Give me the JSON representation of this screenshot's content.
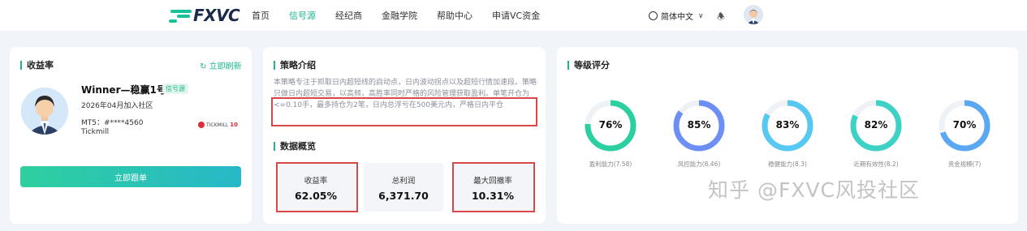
{
  "nav": {
    "logo_text": "FXVC",
    "items": [
      "首页",
      "信号源",
      "经纪商",
      "金融学院",
      "帮助中心",
      "申请VC资金"
    ],
    "active_index": 1,
    "language": "简体中文"
  },
  "profit_card": {
    "title": "收益率",
    "refresh": "立即刷新",
    "trader_name": "Winner—稳赢1号",
    "badge": "信号源",
    "joined": "2026年04月加入社区",
    "mt5": "MT5：#****4560",
    "broker": "Tickmill",
    "broker_logo": "TICKMILL",
    "broker_logo_suffix": "10",
    "follow_button": "立即跟单"
  },
  "strategy_card": {
    "title": "策略介绍",
    "description": "本策略专注于抓取日内超短线的启动点，日内波动拐点以及超短行情加速段。策略只做日内超短交易，以高频，高胜率同时严格的风险管理获取盈利。单笔开仓为<=0.10手，最多持仓为2笔，日内总浮亏在500美元内，严格日内平仓",
    "overview_title": "数据概览",
    "stats": [
      {
        "label": "收益率",
        "value": "62.05%"
      },
      {
        "label": "总利润",
        "value": "6,371.70"
      },
      {
        "label": "最大回撤率",
        "value": "10.31%"
      }
    ]
  },
  "rating_card": {
    "title": "等级评分",
    "gauges": [
      {
        "value": "76%",
        "percent": 76,
        "label": "盈利能力(7.58)",
        "color": "#2ccfa0"
      },
      {
        "value": "85%",
        "percent": 85,
        "label": "风控能力(8.46)",
        "color": "#6c8ef5"
      },
      {
        "value": "83%",
        "percent": 83,
        "label": "稳健能力(8.3)",
        "color": "#56c8f2"
      },
      {
        "value": "82%",
        "percent": 82,
        "label": "近期有效性(8.2)",
        "color": "#3ed2c6"
      },
      {
        "value": "70%",
        "percent": 70,
        "label": "资金规模(7)",
        "color": "#5aa8f2"
      }
    ]
  },
  "watermark": "知乎 @FXVC风投社区"
}
